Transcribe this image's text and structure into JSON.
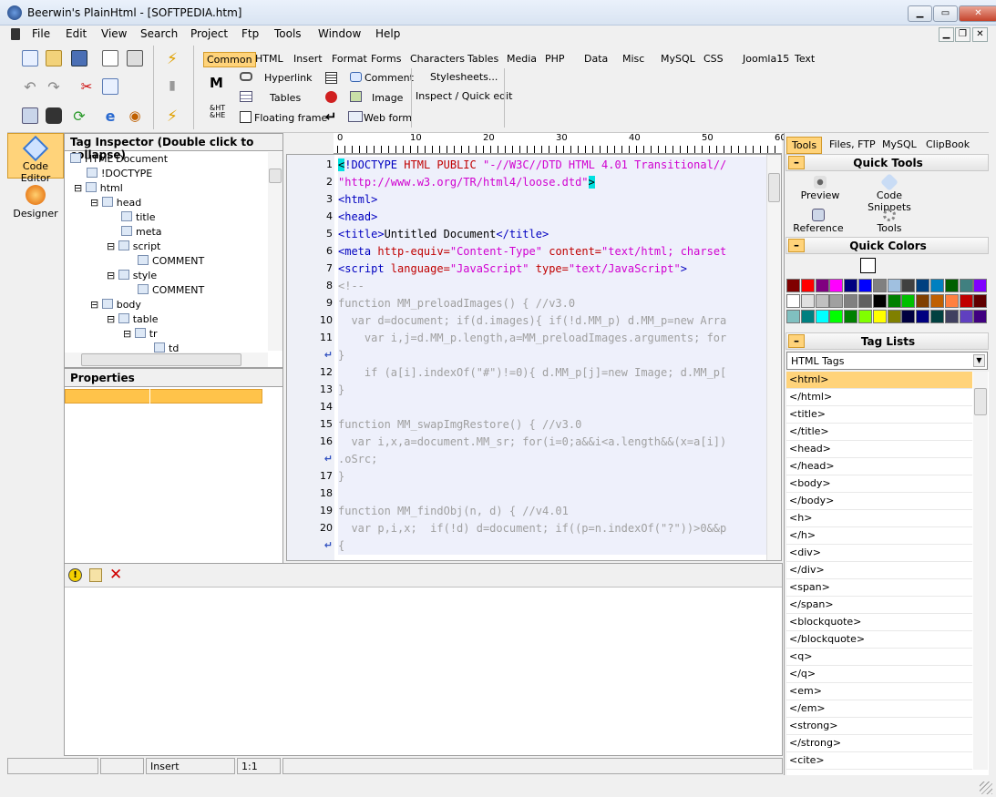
{
  "window": {
    "title": "Beerwin's PlainHtml - [SOFTPEDIA.htm]"
  },
  "menu": [
    "File",
    "Edit",
    "View",
    "Search",
    "Project",
    "Ftp",
    "Tools",
    "Window",
    "Help"
  ],
  "toolbar_tabs": [
    "Common",
    "HTML",
    "Insert",
    "Format",
    "Forms",
    "Characters",
    "Tables",
    "Media",
    "PHP",
    "Data",
    "Misc",
    "MySQL",
    "CSS",
    "Joomla15",
    "Text"
  ],
  "common_items": {
    "hyperlink": "Hyperlink",
    "tables": "Tables",
    "floating_frame": "Floating frame",
    "comment": "Comment",
    "image": "Image",
    "web_form": "Web form",
    "stylesheets": "Stylesheets...",
    "inspect": "Inspect / Quick edit"
  },
  "rail": {
    "code_editor": "Code Editor",
    "designer": "Designer"
  },
  "tag_inspector": {
    "title": "Tag Inspector (Double click to collapse)",
    "nodes": [
      "HTML Document",
      "!DOCTYPE",
      "html",
      "head",
      "title",
      "meta",
      "script",
      "COMMENT",
      "style",
      "COMMENT",
      "body",
      "table",
      "tr",
      "td"
    ]
  },
  "properties": {
    "title": "Properties"
  },
  "ruler": [
    "0",
    "10",
    "20",
    "30",
    "40",
    "50",
    "60"
  ],
  "line_numbers": [
    "1",
    "2",
    "3",
    "4",
    "5",
    "6",
    "7",
    "8",
    "9",
    "10",
    "11",
    "↵",
    "12",
    "13",
    "14",
    "15",
    "16",
    "↵",
    "17",
    "18",
    "19",
    "20",
    "↵"
  ],
  "code": {
    "l1": "<!DOCTYPE HTML PUBLIC \"-//W3C//DTD HTML 4.01 Transitional//",
    "l2": "\"http://www.w3.org/TR/html4/loose.dtd\">",
    "l3": "<html>",
    "l4": "<head>",
    "l5": "<title>Untitled Document</title>",
    "l6": "<meta http-equiv=\"Content-Type\" content=\"text/html; charset",
    "l7": "<script language=\"JavaScript\" type=\"text/JavaScript\">",
    "l8": "<!--",
    "l9": "function MM_preloadImages() { //v3.0",
    "l10": "  var d=document; if(d.images){ if(!d.MM_p) d.MM_p=new Arra",
    "l11": "    var i,j=d.MM_p.length,a=MM_preloadImages.arguments; for",
    "l11b": "}",
    "l12": "    if (a[i].indexOf(\"#\")!=0){ d.MM_p[j]=new Image; d.MM_p[",
    "l13": "}",
    "l14": "",
    "l15": "function MM_swapImgRestore() { //v3.0",
    "l16": "  var i,x,a=document.MM_sr; for(i=0;a&&i<a.length&&(x=a[i])",
    "l16b": ".oSrc;",
    "l17": "}",
    "l18": "",
    "l19": "function MM_findObj(n, d) { //v4.01",
    "l20": "  var p,i,x;  if(!d) d=document; if((p=n.indexOf(\"?\"))>0&&p",
    "l20b": "{"
  },
  "status": {
    "mode": "Insert",
    "position": "1:1"
  },
  "right_tabs": [
    "Tools",
    "Files, FTP",
    "MySQL",
    "ClipBook"
  ],
  "quick_tools": {
    "title": "Quick Tools",
    "items": [
      "Preview",
      "Code Snippets",
      "Reference",
      "Tools"
    ]
  },
  "quick_colors": {
    "title": "Quick Colors",
    "row1": [
      "#800000",
      "#ff0000",
      "#800080",
      "#ff00ff",
      "#000080",
      "#0000ff",
      "#808080",
      "#a0c0e0",
      "#404040",
      "#004080",
      "#0080c0",
      "#006000",
      "#408080",
      "#8000ff"
    ],
    "row2": [
      "#ffffff",
      "#e0e0e0",
      "#c0c0c0",
      "#a0a0a0",
      "#808080",
      "#606060",
      "#000000",
      "#008000",
      "#00c000",
      "#804000",
      "#c06000",
      "#ff8040",
      "#c00000",
      "#600000"
    ],
    "row3": [
      "#80c0c0",
      "#008080",
      "#00ffff",
      "#00ff00",
      "#008000",
      "#80ff00",
      "#ffff00",
      "#808000",
      "#000040",
      "#000080",
      "#004040",
      "#404060",
      "#6040c0",
      "#400080"
    ]
  },
  "tag_lists": {
    "title": "Tag Lists",
    "dropdown": "HTML Tags",
    "tags": [
      "<html>",
      "</html>",
      "<title>",
      "</title>",
      "<head>",
      "</head>",
      "<body>",
      "</body>",
      "<h>",
      "</h>",
      "<div>",
      "</div>",
      "<span>",
      "</span>",
      "<blockquote>",
      "</blockquote>",
      "<q>",
      "</q>",
      "<em>",
      "</em>",
      "<strong>",
      "</strong>",
      "<cite>"
    ]
  }
}
